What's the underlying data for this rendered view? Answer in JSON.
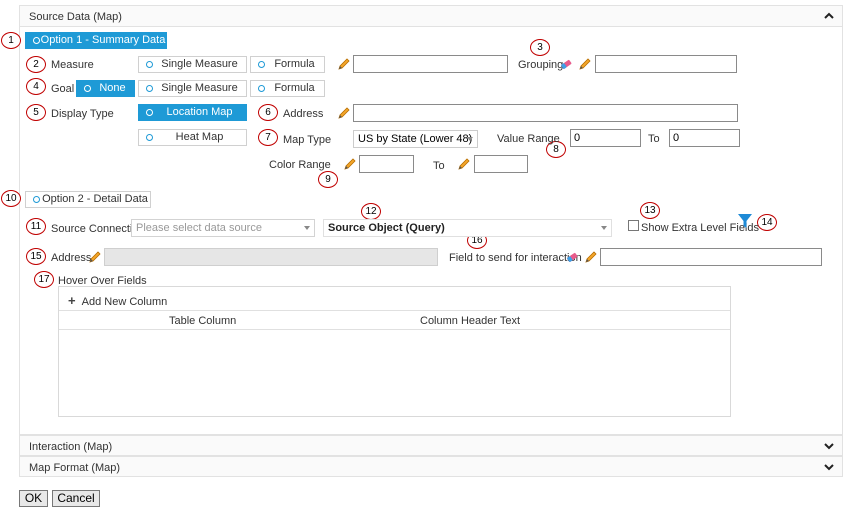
{
  "panels": {
    "source_data": "Source Data (Map)",
    "interaction": "Interaction (Map)",
    "map_format": "Map Format (Map)"
  },
  "callouts": [
    "1",
    "2",
    "3",
    "4",
    "5",
    "6",
    "7",
    "8",
    "9",
    "10",
    "11",
    "12",
    "13",
    "14",
    "15",
    "16",
    "17"
  ],
  "option1": {
    "label": "Option 1 - Summary Data",
    "measure_label": "Measure",
    "single_measure": "Single Measure",
    "formula": "Formula",
    "grouping_label": "Grouping",
    "goal_label": "Goal",
    "none": "None",
    "display_type_label": "Display Type",
    "location_map": "Location Map",
    "heat_map": "Heat Map",
    "address_label": "Address",
    "map_type_label": "Map Type",
    "map_type_value": "US by State (Lower 48)",
    "value_range_label": "Value Range",
    "value_range_from": "0",
    "to_label": "To",
    "value_range_to": "0",
    "color_range_label": "Color Range"
  },
  "option2": {
    "label": "Option 2 - Detail Data",
    "source_connection_label": "Source Connection",
    "source_connection_placeholder": "Please select data source",
    "source_object_label": "Source Object (Query)",
    "show_extra_label": "Show Extra Level Fields",
    "address_label": "Address",
    "field_send_label": "Field to send for interaction",
    "hover_fields_label": "Hover Over Fields",
    "add_column": "Add New Column",
    "columns": [
      "Table Column",
      "Column Header Text"
    ]
  },
  "buttons": {
    "ok": "OK",
    "cancel": "Cancel"
  },
  "colors": {
    "accent": "#1e9ad6",
    "callout": "#c00000"
  }
}
